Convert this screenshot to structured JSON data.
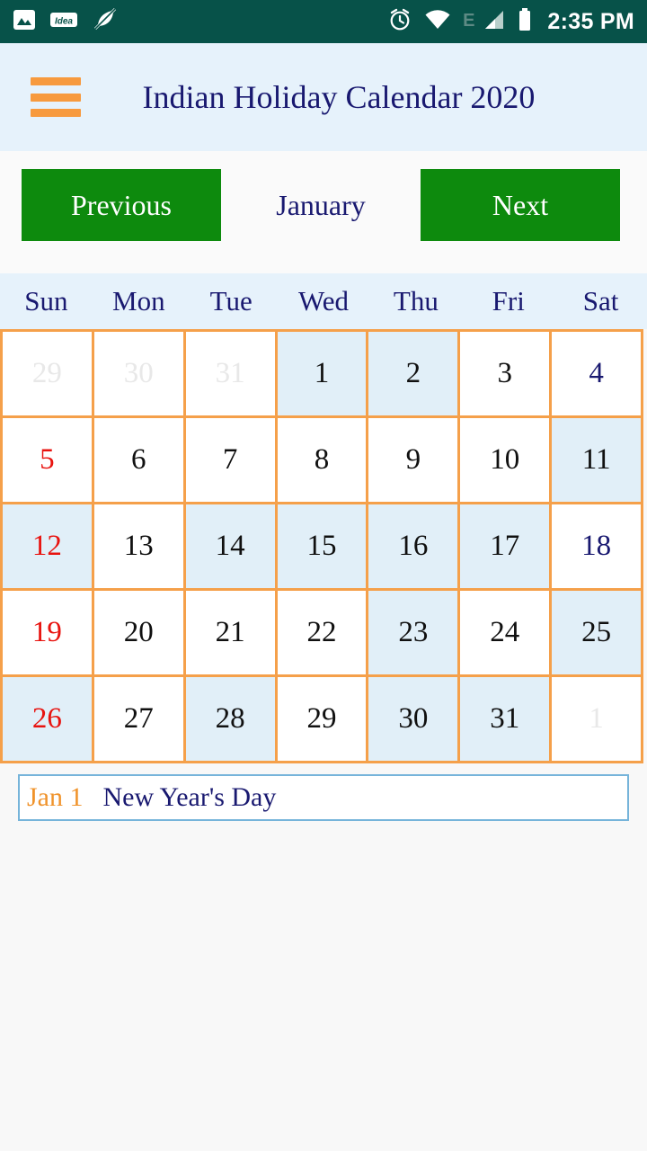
{
  "status_bar": {
    "background": "#075249",
    "left_icons": [
      "photo-icon",
      "idea-badge-icon",
      "leaf-muted-icon"
    ],
    "idea_label": "Idea",
    "right_icons": [
      "alarm-icon",
      "wifi-icon",
      "signal-icon",
      "battery-icon"
    ],
    "network_type": "E",
    "clock": "2:35 PM"
  },
  "header": {
    "menu_icon": "hamburger-menu-icon",
    "title": "Indian Holiday Calendar 2020",
    "title_color": "#191970",
    "background": "#e6f2fb",
    "accent": "#f79a3e"
  },
  "month_nav": {
    "previous_label": "Previous",
    "next_label": "Next",
    "current_month": "January",
    "button_color": "#0d8a0d"
  },
  "weekdays": [
    "Sun",
    "Mon",
    "Tue",
    "Wed",
    "Thu",
    "Fri",
    "Sat"
  ],
  "calendar": {
    "border_color": "#f5a04a",
    "highlight_color": "#e1eff8",
    "sunday_color": "#e8130f",
    "saturday_color": "#191970",
    "muted_color": "#e8e8e8",
    "weeks": [
      [
        {
          "day": "29",
          "style": "muted"
        },
        {
          "day": "30",
          "style": "muted"
        },
        {
          "day": "31",
          "style": "muted"
        },
        {
          "day": "1",
          "style": "hl"
        },
        {
          "day": "2",
          "style": "hl"
        },
        {
          "day": "3",
          "style": ""
        },
        {
          "day": "4",
          "style": "sat"
        }
      ],
      [
        {
          "day": "5",
          "style": "sun"
        },
        {
          "day": "6",
          "style": ""
        },
        {
          "day": "7",
          "style": ""
        },
        {
          "day": "8",
          "style": ""
        },
        {
          "day": "9",
          "style": ""
        },
        {
          "day": "10",
          "style": ""
        },
        {
          "day": "11",
          "style": "hl"
        }
      ],
      [
        {
          "day": "12",
          "style": "sun hl"
        },
        {
          "day": "13",
          "style": ""
        },
        {
          "day": "14",
          "style": "hl"
        },
        {
          "day": "15",
          "style": "hl"
        },
        {
          "day": "16",
          "style": "hl"
        },
        {
          "day": "17",
          "style": "hl"
        },
        {
          "day": "18",
          "style": "sat"
        }
      ],
      [
        {
          "day": "19",
          "style": "sun"
        },
        {
          "day": "20",
          "style": ""
        },
        {
          "day": "21",
          "style": ""
        },
        {
          "day": "22",
          "style": ""
        },
        {
          "day": "23",
          "style": "hl"
        },
        {
          "day": "24",
          "style": ""
        },
        {
          "day": "25",
          "style": "hl"
        }
      ],
      [
        {
          "day": "26",
          "style": "sun hl"
        },
        {
          "day": "27",
          "style": ""
        },
        {
          "day": "28",
          "style": "hl"
        },
        {
          "day": "29",
          "style": ""
        },
        {
          "day": "30",
          "style": "hl"
        },
        {
          "day": "31",
          "style": "hl"
        },
        {
          "day": "1",
          "style": "muted"
        }
      ]
    ]
  },
  "holidays": [
    {
      "date": "Jan 1",
      "name": "New Year's Day"
    }
  ]
}
